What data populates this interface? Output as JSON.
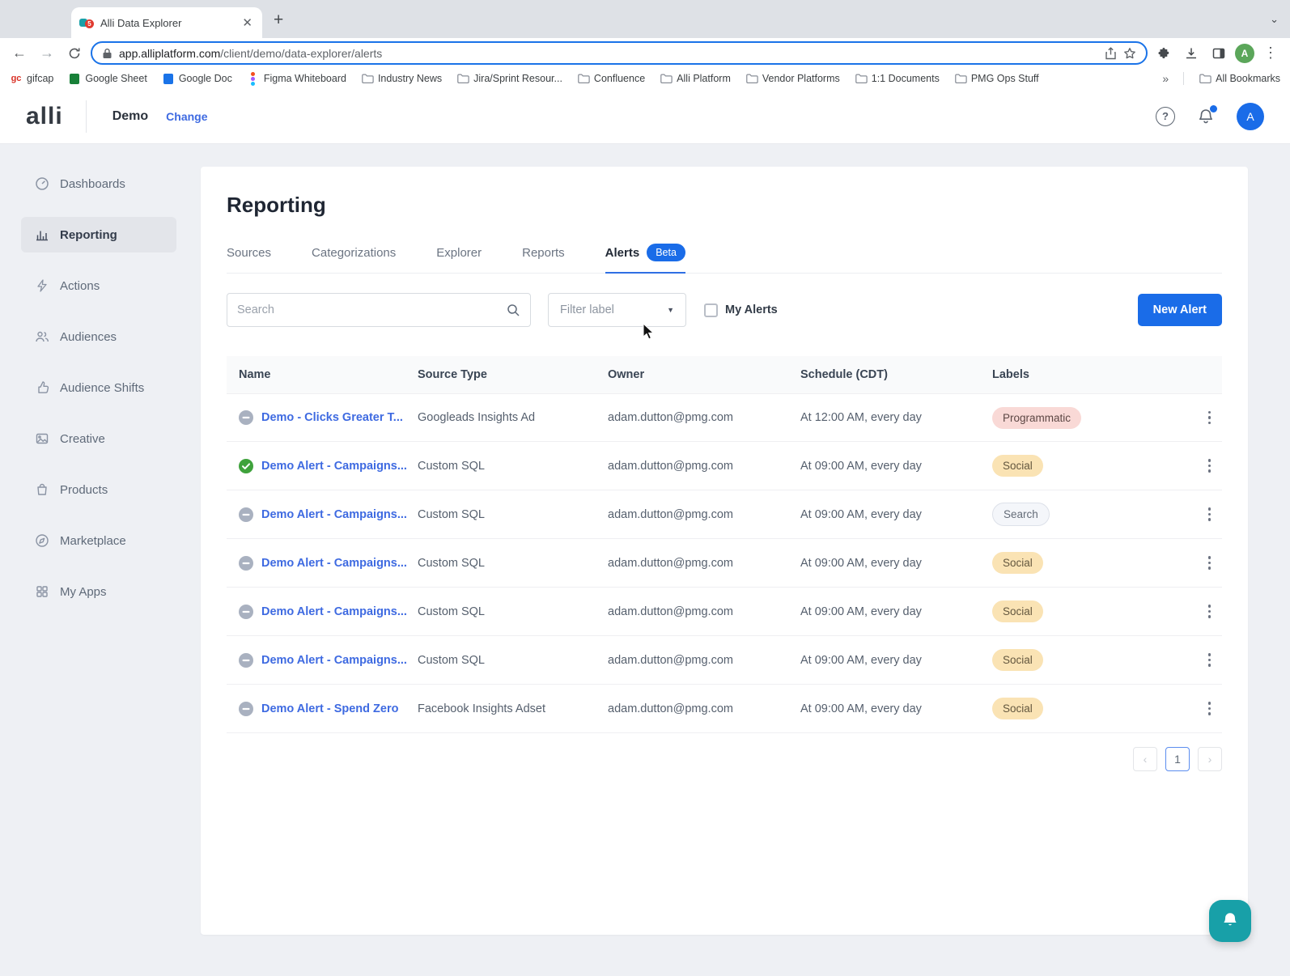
{
  "browser": {
    "tab_title": "Alli Data Explorer",
    "favicon_badge": "5",
    "close_glyph": "✕",
    "url_host": "app.alliplatform.com",
    "url_path": "/client/demo/data-explorer/alerts",
    "avatar_initial": "A",
    "bookmarks": [
      {
        "label": "gifcap",
        "icon": "gifcap-icon"
      },
      {
        "label": "Google Sheet",
        "icon": "google-sheet-icon"
      },
      {
        "label": "Google Doc",
        "icon": "google-doc-icon"
      },
      {
        "label": "Figma Whiteboard",
        "icon": "figma-icon"
      },
      {
        "label": "Industry News",
        "icon": "folder-icon"
      },
      {
        "label": "Jira/Sprint Resour...",
        "icon": "folder-icon"
      },
      {
        "label": "Confluence",
        "icon": "folder-icon"
      },
      {
        "label": "Alli Platform",
        "icon": "folder-icon"
      },
      {
        "label": "Vendor Platforms",
        "icon": "folder-icon"
      },
      {
        "label": "1:1 Documents",
        "icon": "folder-icon"
      },
      {
        "label": "PMG Ops Stuff",
        "icon": "folder-icon"
      }
    ],
    "bookmarks_overflow": "»",
    "all_bookmarks_label": "All Bookmarks"
  },
  "header": {
    "logo": "alli",
    "client_name": "Demo",
    "change_link": "Change",
    "help_glyph": "?",
    "avatar_initial": "A"
  },
  "sidebar": {
    "items": [
      {
        "label": "Dashboards",
        "icon": "dashboard-icon",
        "state": ""
      },
      {
        "label": "Reporting",
        "icon": "reporting-icon",
        "state": "active"
      },
      {
        "label": "Actions",
        "icon": "actions-icon",
        "state": ""
      },
      {
        "label": "Audiences",
        "icon": "audiences-icon",
        "state": ""
      },
      {
        "label": "Audience Shifts",
        "icon": "audience-shifts-icon",
        "state": ""
      },
      {
        "label": "Creative",
        "icon": "creative-icon",
        "state": ""
      },
      {
        "label": "Products",
        "icon": "products-icon",
        "state": ""
      },
      {
        "label": "Marketplace",
        "icon": "marketplace-icon",
        "state": ""
      },
      {
        "label": "My Apps",
        "icon": "my-apps-icon",
        "state": ""
      }
    ]
  },
  "main": {
    "title": "Reporting",
    "tabs": [
      {
        "label": "Sources",
        "state": "",
        "badge": ""
      },
      {
        "label": "Categorizations",
        "state": "",
        "badge": ""
      },
      {
        "label": "Explorer",
        "state": "",
        "badge": ""
      },
      {
        "label": "Reports",
        "state": "",
        "badge": ""
      },
      {
        "label": "Alerts",
        "state": "active",
        "badge": "Beta"
      }
    ],
    "search_placeholder": "Search",
    "filter_label": "Filter label",
    "my_alerts_label": "My Alerts",
    "new_alert_button": "New Alert",
    "table": {
      "columns": [
        "Name",
        "Source Type",
        "Owner",
        "Schedule (CDT)",
        "Labels"
      ],
      "rows": [
        {
          "status_icon": "paused-icon",
          "name": "Demo - Clicks Greater T...",
          "source_type": "Googleads Insights Ad",
          "owner": "adam.dutton@pmg.com",
          "schedule": "At 12:00 AM, every day",
          "label": "Programmatic",
          "label_type": "programmatic"
        },
        {
          "status_icon": "check-icon",
          "name": "Demo Alert - Campaigns...",
          "source_type": "Custom SQL",
          "owner": "adam.dutton@pmg.com",
          "schedule": "At 09:00 AM, every day",
          "label": "Social",
          "label_type": "social"
        },
        {
          "status_icon": "paused-icon",
          "name": "Demo Alert - Campaigns...",
          "source_type": "Custom SQL",
          "owner": "adam.dutton@pmg.com",
          "schedule": "At 09:00 AM, every day",
          "label": "Search",
          "label_type": "search"
        },
        {
          "status_icon": "paused-icon",
          "name": "Demo Alert - Campaigns...",
          "source_type": "Custom SQL",
          "owner": "adam.dutton@pmg.com",
          "schedule": "At 09:00 AM, every day",
          "label": "Social",
          "label_type": "social"
        },
        {
          "status_icon": "paused-icon",
          "name": "Demo Alert - Campaigns...",
          "source_type": "Custom SQL",
          "owner": "adam.dutton@pmg.com",
          "schedule": "At 09:00 AM, every day",
          "label": "Social",
          "label_type": "social"
        },
        {
          "status_icon": "paused-icon",
          "name": "Demo Alert - Campaigns...",
          "source_type": "Custom SQL",
          "owner": "adam.dutton@pmg.com",
          "schedule": "At 09:00 AM, every day",
          "label": "Social",
          "label_type": "social"
        },
        {
          "status_icon": "paused-icon",
          "name": "Demo Alert - Spend Zero",
          "source_type": "Facebook Insights Adset",
          "owner": "adam.dutton@pmg.com",
          "schedule": "At 09:00 AM, every day",
          "label": "Social",
          "label_type": "social"
        }
      ]
    },
    "pagination": {
      "prev": "‹",
      "page": "1",
      "next": "›"
    }
  },
  "colors": {
    "accent_blue": "#1a6ce8",
    "link_blue": "#3e6ae1",
    "beta_badge": "#1a6ce8",
    "status_paused_gray": "#a9b1c0",
    "status_active_green": "#3fa23c",
    "label_programmatic_bg": "#f9d9d6",
    "label_social_bg": "#fae3b4",
    "label_search_bg": "#f4f6fa",
    "chat_fab_teal": "#18a0a8",
    "url_focus_ring": "#1a73e8"
  }
}
